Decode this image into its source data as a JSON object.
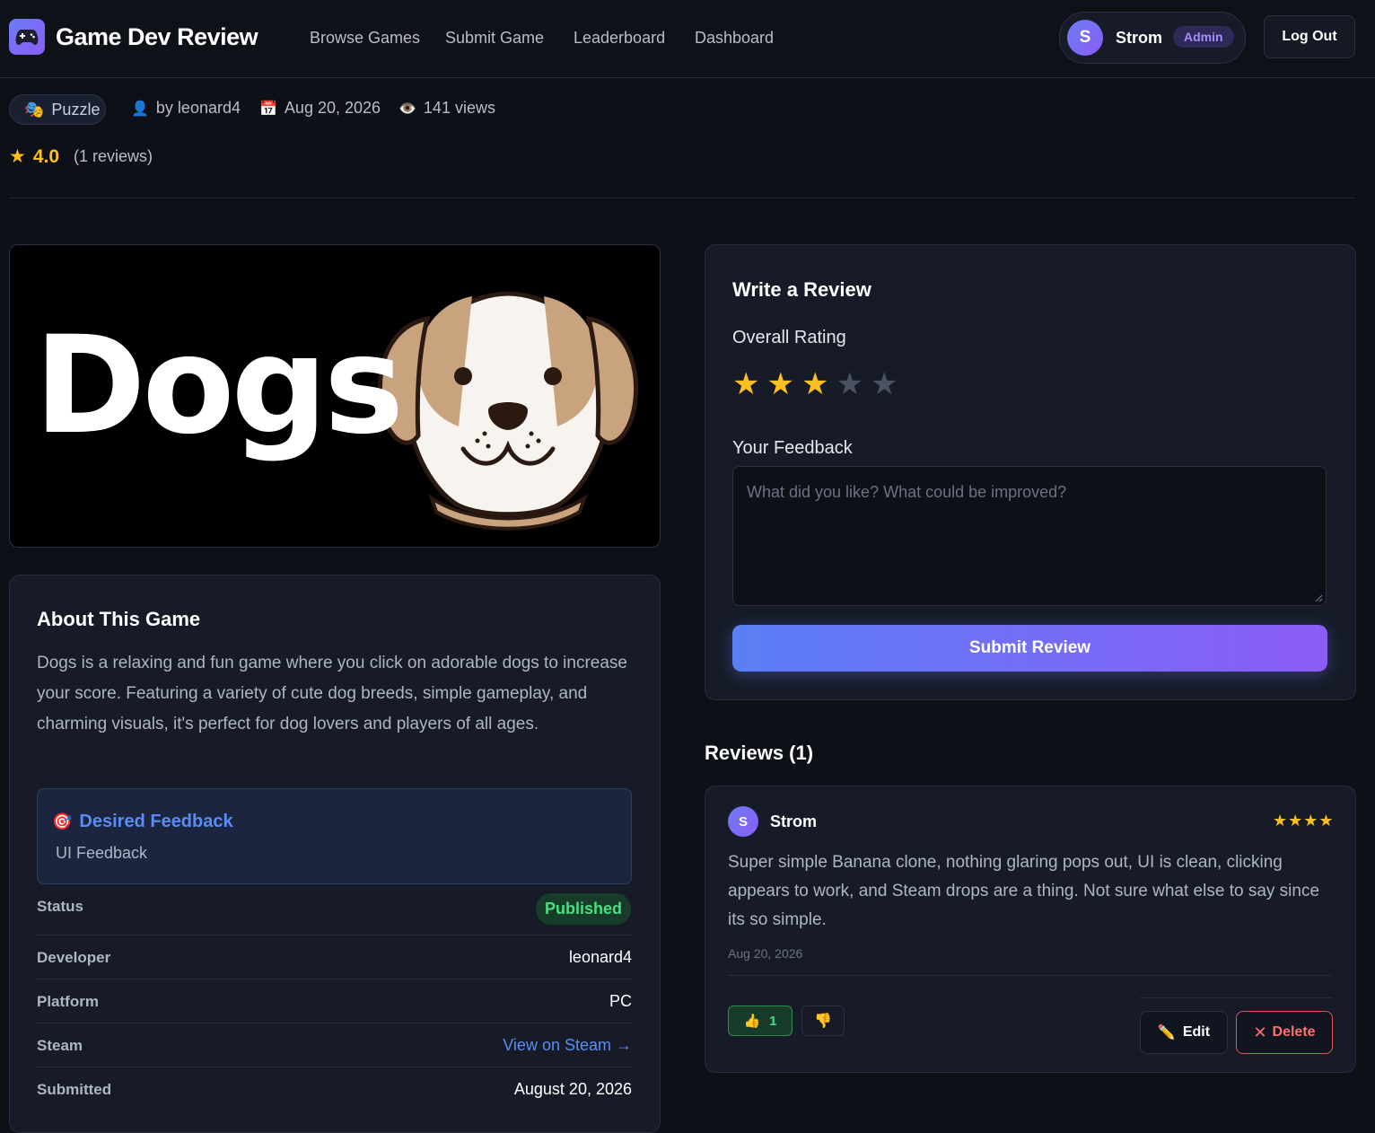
{
  "header": {
    "brand": "Game Dev Review",
    "nav": [
      "Browse Games",
      "Submit Game",
      "Leaderboard",
      "Dashboard"
    ],
    "user_initial": "S",
    "user_name": "Strom",
    "role_badge": "Admin",
    "logout_label": "Log Out"
  },
  "game": {
    "genre": "Puzzle",
    "author": "by leonard4",
    "date": "Aug 20, 2026",
    "views": "141 views",
    "rating": "4.0",
    "review_count": "(1 reviews)",
    "cover_title": "Dogs"
  },
  "about": {
    "heading": "About This Game",
    "description": "Dogs is a relaxing and fun game where you click on adorable dogs to increase your score. Featuring a variety of cute dog breeds, simple gameplay, and charming visuals, it's perfect for dog lovers and players of all ages.",
    "desired_feedback_title": "Desired Feedback",
    "desired_feedback_value": "UI Feedback",
    "status_label": "Status",
    "status_value": "Published",
    "developer_label": "Developer",
    "developer_value": "leonard4",
    "platform_label": "Platform",
    "platform_value": "PC",
    "steam_label": "Steam",
    "steam_value": "View on Steam →",
    "submitted_label": "Submitted",
    "submitted_value": "August 20, 2026"
  },
  "write_review": {
    "heading": "Write a Review",
    "rating_label": "Overall Rating",
    "selected_rating": 3,
    "max_rating": 5,
    "feedback_label": "Your Feedback",
    "feedback_placeholder": "What did you like? What could be improved?",
    "feedback_value": "",
    "submit_label": "Submit Review"
  },
  "reviews": {
    "heading": "Reviews (1)",
    "items": [
      {
        "initial": "S",
        "name": "Strom",
        "stars": 4,
        "text": "Super simple Banana clone, nothing glaring pops out, UI is clean, clicking appears to work, and Steam drops are a thing. Not sure what else to say since its so simple.",
        "date": "Aug 20, 2026",
        "upvotes": "1",
        "edit_label": "Edit",
        "delete_label": "Delete"
      }
    ]
  },
  "colors": {
    "accent": "#6b7cf5",
    "accent2": "#8b5cf6",
    "star": "#fbbf24",
    "success": "#4ade80",
    "danger": "#f87171",
    "link": "#5b8cf5",
    "background": "#0d1017",
    "card": "#161b27"
  }
}
